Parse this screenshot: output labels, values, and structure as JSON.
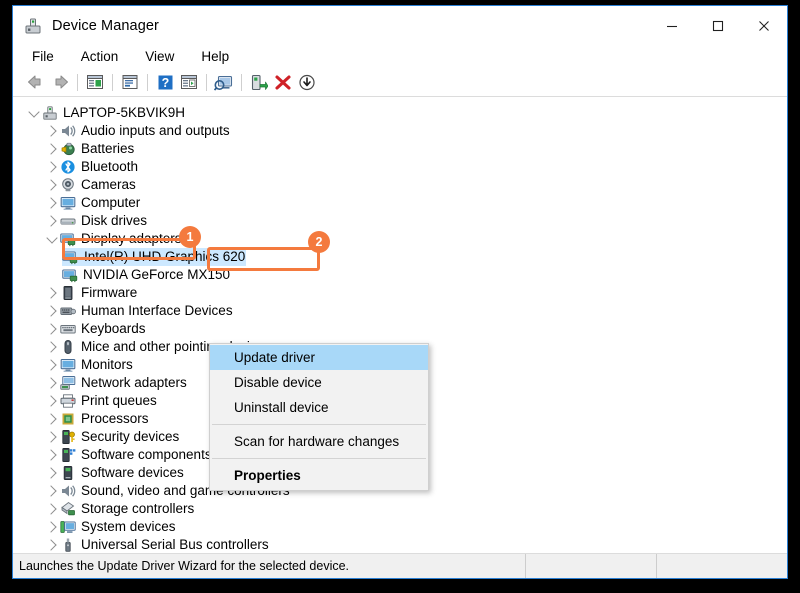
{
  "window": {
    "title": "Device Manager",
    "icon": "device-manager-icon",
    "minimize_label": "–",
    "maximize_label": "☐",
    "close_label": "✕"
  },
  "menubar": {
    "items": [
      {
        "label": "File",
        "name": "menu-file"
      },
      {
        "label": "Action",
        "name": "menu-action"
      },
      {
        "label": "View",
        "name": "menu-view"
      },
      {
        "label": "Help",
        "name": "menu-help"
      }
    ]
  },
  "toolbar": {
    "buttons": [
      {
        "name": "back-icon",
        "title": "Back"
      },
      {
        "name": "forward-icon",
        "title": "Forward"
      },
      {
        "name": "show-hide-console-tree-icon",
        "title": "Show/Hide Console Tree"
      },
      {
        "name": "properties-icon",
        "title": "Properties"
      },
      {
        "name": "help-icon",
        "title": "Help"
      },
      {
        "name": "show-hide-action-pane-icon",
        "title": "Show/Hide Action Pane"
      },
      {
        "name": "scan-for-hardware-changes-icon",
        "title": "Scan for hardware changes"
      },
      {
        "name": "update-driver-icon",
        "title": "Update driver"
      },
      {
        "name": "uninstall-device-icon",
        "title": "Uninstall device"
      },
      {
        "name": "disable-device-icon",
        "title": "Disable device"
      }
    ]
  },
  "tree": {
    "root": {
      "label": "LAPTOP-5KBVIK9H",
      "icon": "computer-root-icon",
      "expanded": true
    },
    "nodes": [
      {
        "label": "Audio inputs and outputs",
        "icon": "speaker-icon",
        "expanded": false
      },
      {
        "label": "Batteries",
        "icon": "battery-icon",
        "expanded": false
      },
      {
        "label": "Bluetooth",
        "icon": "bluetooth-icon",
        "expanded": false
      },
      {
        "label": "Cameras",
        "icon": "camera-icon",
        "expanded": false
      },
      {
        "label": "Computer",
        "icon": "monitor-icon",
        "expanded": false
      },
      {
        "label": "Disk drives",
        "icon": "disk-drive-icon",
        "expanded": false
      },
      {
        "label": "Display adapters",
        "icon": "display-adapter-icon",
        "expanded": true
      },
      {
        "label": "Firmware",
        "icon": "firmware-icon",
        "expanded": false
      },
      {
        "label": "Human Interface Devices",
        "icon": "hid-icon",
        "expanded": false
      },
      {
        "label": "Keyboards",
        "icon": "keyboard-icon",
        "expanded": false
      },
      {
        "label": "Mice and other pointing devices",
        "icon": "mouse-icon",
        "expanded": false
      },
      {
        "label": "Monitors",
        "icon": "monitor-icon",
        "expanded": false
      },
      {
        "label": "Network adapters",
        "icon": "network-adapter-icon",
        "expanded": false
      },
      {
        "label": "Print queues",
        "icon": "printer-icon",
        "expanded": false
      },
      {
        "label": "Processors",
        "icon": "processor-icon",
        "expanded": false
      },
      {
        "label": "Security devices",
        "icon": "security-device-icon",
        "expanded": false
      },
      {
        "label": "Software components",
        "icon": "software-component-icon",
        "expanded": false
      },
      {
        "label": "Software devices",
        "icon": "software-device-icon",
        "expanded": false
      },
      {
        "label": "Sound, video and game controllers",
        "icon": "speaker-icon",
        "expanded": false
      },
      {
        "label": "Storage controllers",
        "icon": "storage-controller-icon",
        "expanded": false
      },
      {
        "label": "System devices",
        "icon": "system-device-icon",
        "expanded": false
      },
      {
        "label": "Universal Serial Bus controllers",
        "icon": "usb-icon",
        "expanded": false
      }
    ],
    "display_children": [
      {
        "label": "Intel(R) UHD Graphics 620",
        "icon": "display-adapter-icon",
        "selected": true
      },
      {
        "label": "NVIDIA GeForce MX150",
        "icon": "display-adapter-icon",
        "selected": false
      }
    ]
  },
  "context_menu": {
    "items": [
      {
        "label": "Update driver",
        "highlighted": true,
        "bold": false
      },
      {
        "label": "Disable device",
        "highlighted": false,
        "bold": false
      },
      {
        "label": "Uninstall device",
        "highlighted": false,
        "bold": false
      },
      {
        "separator": true
      },
      {
        "label": "Scan for hardware changes",
        "highlighted": false,
        "bold": false
      },
      {
        "separator": true
      },
      {
        "label": "Properties",
        "highlighted": false,
        "bold": true
      }
    ]
  },
  "statusbar": {
    "message": "Launches the Update Driver Wizard for the selected device."
  },
  "annotations": {
    "accent_color": "#f47a3e",
    "badges": [
      {
        "label": "1",
        "name": "annotation-badge-1"
      },
      {
        "label": "2",
        "name": "annotation-badge-2"
      }
    ]
  }
}
